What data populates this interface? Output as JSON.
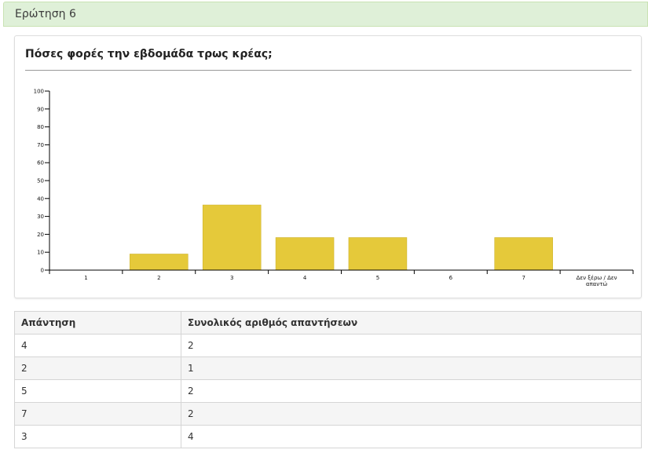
{
  "header": {
    "title": "Ερώτηση 6"
  },
  "chart_data": {
    "type": "bar",
    "title": "Πόσες φορές την εβδομάδα τρως κρέας;",
    "xlabel": "",
    "ylabel": "",
    "categories": [
      "1",
      "2",
      "3",
      "4",
      "5",
      "6",
      "7",
      "Δεν ξέρω / Δεν απαντώ"
    ],
    "values": [
      0,
      9,
      36.4,
      18.2,
      18.2,
      0,
      18.2,
      0
    ],
    "ylim": [
      0,
      100
    ],
    "yticks": [
      0,
      10,
      20,
      30,
      40,
      50,
      60,
      70,
      80,
      90,
      100
    ],
    "grid": false,
    "legend": "none",
    "bar_color": "#e5c93a"
  },
  "table": {
    "headers": [
      "Απάντηση",
      "Συνολικός αριθμός απαντήσεων"
    ],
    "rows": [
      [
        "4",
        "2"
      ],
      [
        "2",
        "1"
      ],
      [
        "5",
        "2"
      ],
      [
        "7",
        "2"
      ],
      [
        "3",
        "4"
      ]
    ]
  }
}
